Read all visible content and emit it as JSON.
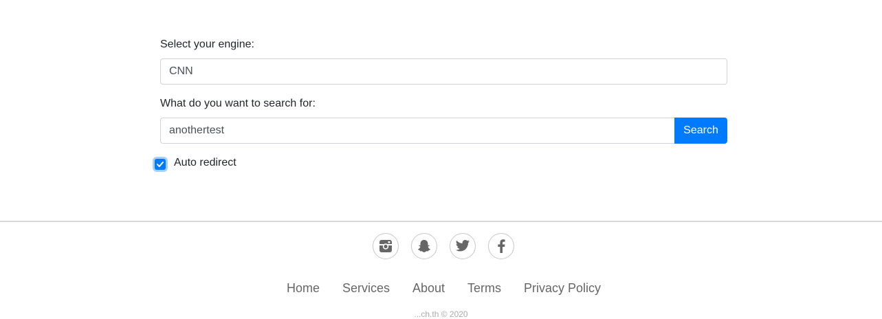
{
  "form": {
    "engine_label": "Select your engine:",
    "engine_value": "CNN",
    "query_label": "What do you want to search for:",
    "query_value": "anothertest",
    "search_button": "Search",
    "auto_redirect_label": "Auto redirect",
    "auto_redirect_checked": true
  },
  "footer": {
    "social_icons": [
      "instagram-icon",
      "snapchat-icon",
      "twitter-icon",
      "facebook-icon"
    ],
    "nav": [
      "Home",
      "Services",
      "About",
      "Terms",
      "Privacy Policy"
    ],
    "copyright": "...ch.th © 2020"
  },
  "colors": {
    "accent": "#007bff",
    "nav_text": "#666666",
    "icon": "#666666"
  }
}
